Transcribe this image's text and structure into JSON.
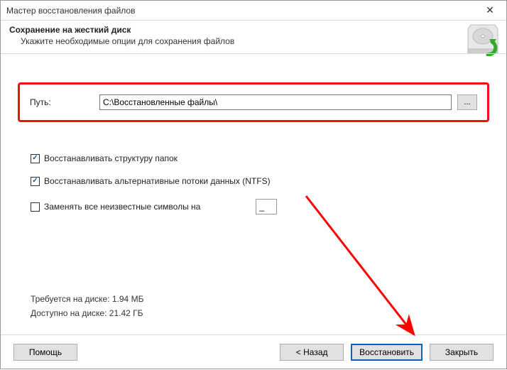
{
  "window": {
    "title": "Мастер восстановления файлов"
  },
  "header": {
    "title": "Сохранение на жесткий диск",
    "subtitle": "Укажите необходимые опции для сохранения файлов"
  },
  "path": {
    "label": "Путь:",
    "value": "C:\\Восстановленные файлы\\",
    "browse_label": "..."
  },
  "options": {
    "restore_structure": {
      "checked": true,
      "label": "Восстанавливать структуру папок"
    },
    "restore_streams": {
      "checked": true,
      "label": "Восстанавливать альтернативные потоки данных (NTFS)"
    },
    "replace_unknown": {
      "checked": false,
      "label": "Заменять все неизвестные символы на",
      "value": "_"
    }
  },
  "disk": {
    "required": "Требуется на диске: 1.94 МБ",
    "available": "Доступно на диске: 21.42 ГБ"
  },
  "footer": {
    "help": "Помощь",
    "back": "< Назад",
    "recover": "Восстановить",
    "close": "Закрыть"
  }
}
